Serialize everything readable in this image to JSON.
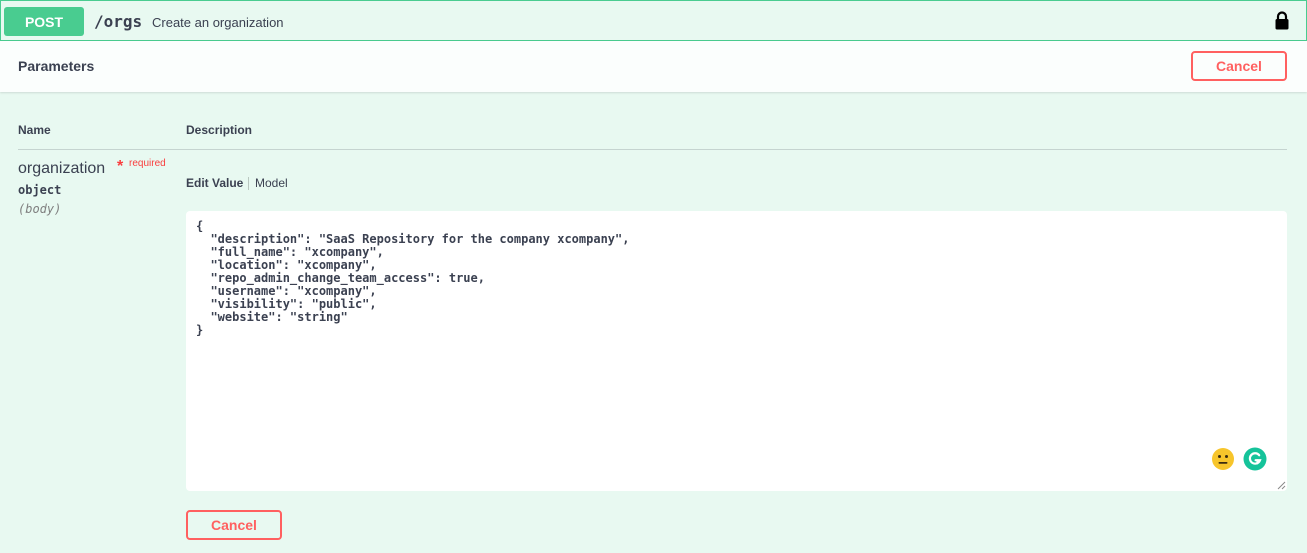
{
  "operation": {
    "method": "POST",
    "path": "/orgs",
    "summary": "Create an organization"
  },
  "parameters_section": {
    "title": "Parameters",
    "cancel_label": "Cancel"
  },
  "table": {
    "col_name": "Name",
    "col_description": "Description"
  },
  "parameter": {
    "name": "organization",
    "required_star": "*",
    "required_label": "required",
    "type": "object",
    "in": "(body)"
  },
  "tabs": {
    "edit_value": "Edit Value",
    "model": "Model"
  },
  "body_value": "{\n  \"description\": \"SaaS Repository for the company xcompany\",\n  \"full_name\": \"xcompany\",\n  \"location\": \"xcompany\",\n  \"repo_admin_change_team_access\": true,\n  \"username\": \"xcompany\",\n  \"visibility\": \"public\",\n  \"website\": \"string\"\n}",
  "footer": {
    "cancel_label": "Cancel"
  },
  "colors": {
    "post_green": "#49cc90",
    "cancel_red": "#ff6060",
    "required_red": "#f93e3e",
    "background": "#e8f9f1"
  },
  "icons": {
    "lock": "lock-icon",
    "emoji": "neutral-face-emoji-icon",
    "grammarly": "grammarly-icon",
    "resize": "resize-grip-icon"
  }
}
